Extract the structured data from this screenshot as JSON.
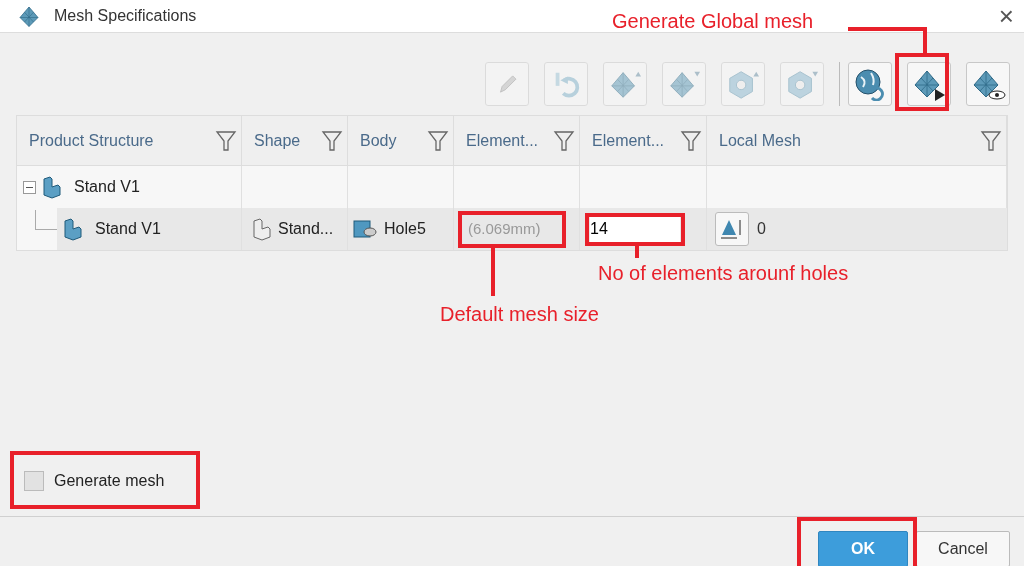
{
  "window": {
    "title": "Mesh Specifications",
    "close": "×"
  },
  "toolbar": [
    {
      "kind": "pencil",
      "disabled": true
    },
    {
      "kind": "revert",
      "disabled": true
    },
    {
      "kind": "pyramid-up",
      "disabled": true
    },
    {
      "kind": "pyramid-down",
      "disabled": true
    },
    {
      "kind": "ring-up",
      "disabled": true
    },
    {
      "kind": "ring-down",
      "disabled": true
    },
    {
      "kind": "globe-revert",
      "disabled": false
    },
    {
      "kind": "mesh-run",
      "disabled": false
    },
    {
      "kind": "mesh-view",
      "disabled": false
    }
  ],
  "table": {
    "columns": [
      "Product Structure",
      "Shape",
      "Body",
      "Element...",
      "Element...",
      "Local Mesh"
    ],
    "rows": [
      {
        "name": "Stand V1",
        "expanded": true,
        "selected": false,
        "children": [
          {
            "name": "Stand V1",
            "selected": true,
            "shape": "Stand...",
            "body": "Hole5",
            "element_size": "(6.069mm)",
            "element_count": "14",
            "local_mesh": "0"
          }
        ]
      }
    ]
  },
  "generate_mesh": {
    "label": "Generate mesh",
    "checked": false
  },
  "buttons": [
    {
      "label": "OK",
      "kind": "primary"
    },
    {
      "label": "Cancel",
      "kind": "secondary"
    }
  ],
  "annotations": [
    "Generate Global mesh",
    "Default mesh size",
    "No of elements arounf holes"
  ]
}
